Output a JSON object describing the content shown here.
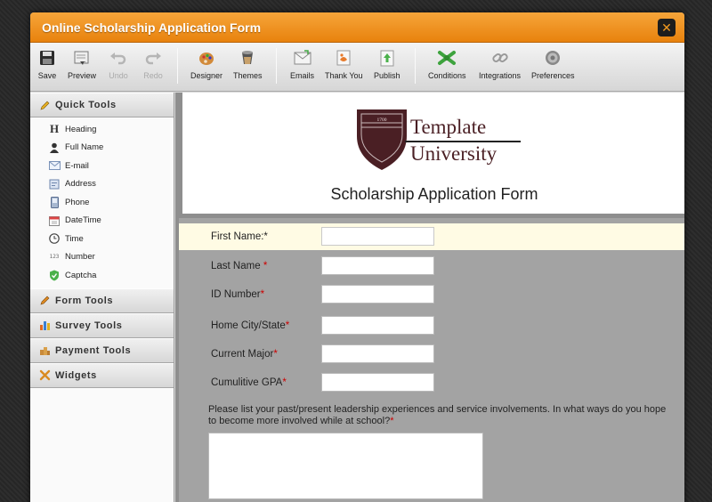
{
  "window": {
    "title": "Online Scholarship Application Form"
  },
  "toolbar": {
    "save": "Save",
    "preview": "Preview",
    "undo": "Undo",
    "redo": "Redo",
    "designer": "Designer",
    "themes": "Themes",
    "emails": "Emails",
    "thank_you": "Thank You",
    "publish": "Publish",
    "conditions": "Conditions",
    "integrations": "Integrations",
    "preferences": "Preferences"
  },
  "sidebar": {
    "quick_tools": {
      "label": "Quick Tools",
      "items": [
        {
          "label": "Heading",
          "icon": "heading-icon"
        },
        {
          "label": "Full Name",
          "icon": "person-icon"
        },
        {
          "label": "E-mail",
          "icon": "envelope-icon"
        },
        {
          "label": "Address",
          "icon": "address-icon"
        },
        {
          "label": "Phone",
          "icon": "phone-icon"
        },
        {
          "label": "DateTime",
          "icon": "calendar-icon"
        },
        {
          "label": "Time",
          "icon": "clock-icon"
        },
        {
          "label": "Number",
          "icon": "number-icon"
        },
        {
          "label": "Captcha",
          "icon": "shield-icon"
        }
      ]
    },
    "form_tools": "Form Tools",
    "survey_tools": "Survey Tools",
    "payment_tools": "Payment Tools",
    "widgets": "Widgets"
  },
  "form": {
    "logo": {
      "year": "1700",
      "line1": "Template",
      "line2": "University"
    },
    "title": "Scholarship Application Form",
    "fields": [
      {
        "label": "First Name:",
        "value": ""
      },
      {
        "label": "Last Name",
        "value": ""
      },
      {
        "label": "ID Number",
        "value": ""
      },
      {
        "label": "Home City/State",
        "value": ""
      },
      {
        "label": "Current Major",
        "value": ""
      },
      {
        "label": "Cumulitive GPA",
        "value": ""
      }
    ],
    "required_mark": "*",
    "question": "Please list your past/present leadership experiences and service involvements. In what ways do you hope to become more involved while at school?",
    "question_value": ""
  },
  "colors": {
    "titlebar": "#f39a1f",
    "required": "#cc0000",
    "brand_maroon": "#4a1f24",
    "active_row": "#fffbe4"
  }
}
